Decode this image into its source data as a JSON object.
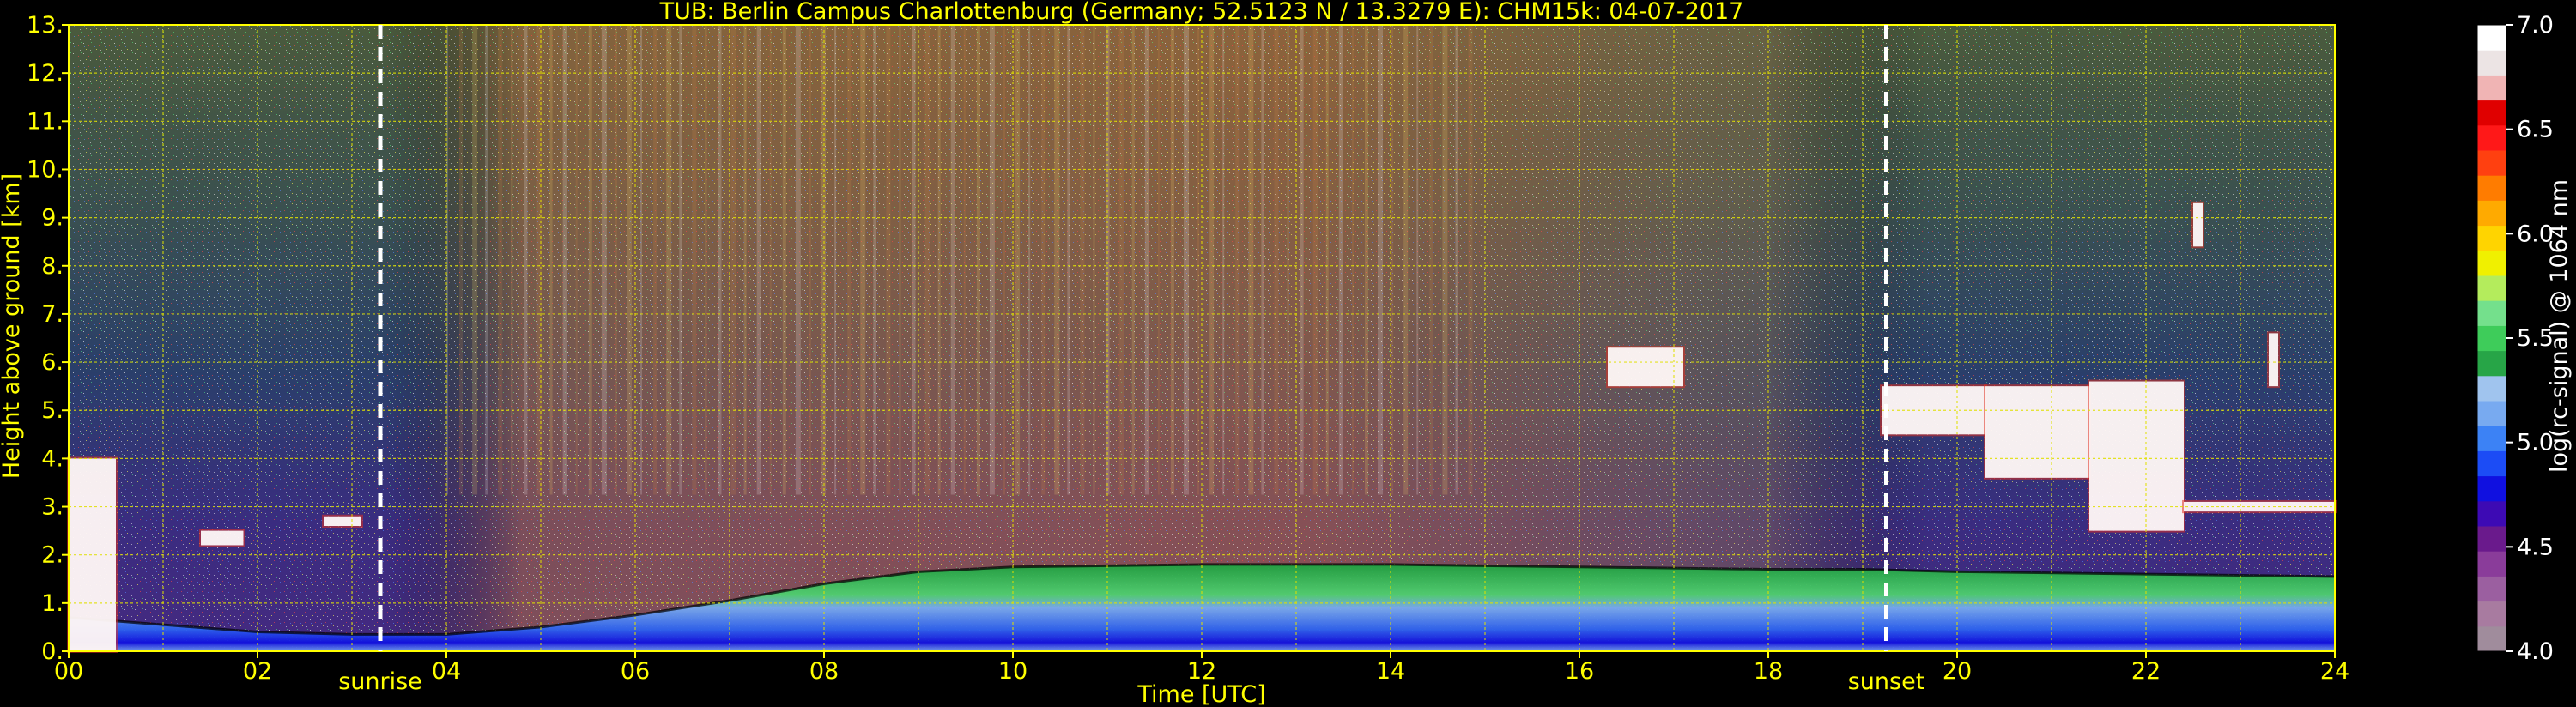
{
  "chart_data": {
    "type": "heatmap",
    "title": "TUB: Berlin Campus Charlottenburg (Germany; 52.5123 N / 13.3279 E):    CHM15k: 04-07-2017",
    "xlabel": "Time [UTC]",
    "ylabel": "Height above ground [km]",
    "xlim": [
      0,
      24
    ],
    "ylim": [
      0,
      13
    ],
    "x_ticks": [
      "00",
      "02",
      "04",
      "06",
      "08",
      "10",
      "12",
      "14",
      "16",
      "18",
      "20",
      "22",
      "24"
    ],
    "y_ticks": [
      "0.",
      "1.",
      "2.",
      "3.",
      "4.",
      "5.",
      "6.",
      "7.",
      "8.",
      "9.",
      "10.",
      "11.",
      "12.",
      "13."
    ],
    "grid": true,
    "annotations": [
      {
        "label": "sunrise",
        "time": 3.3
      },
      {
        "label": "sunset",
        "time": 19.25
      }
    ],
    "colorbar": {
      "label": "log(rc-signal) @ 1064 nm",
      "range": [
        4.0,
        7.0
      ],
      "ticks": [
        "4.0",
        "4.5",
        "5.0",
        "5.5",
        "6.0",
        "6.5",
        "7.0"
      ],
      "colors": [
        "#a08c9c",
        "#a87ba0",
        "#9b5fa0",
        "#8a3c9a",
        "#6a1a8c",
        "#3d0ab4",
        "#1010e0",
        "#1c4cf5",
        "#3c82f5",
        "#78aaf0",
        "#a0c4ee",
        "#27a547",
        "#3ecc5a",
        "#74e08c",
        "#b4ec5c",
        "#f0f000",
        "#ffd400",
        "#ffaa00",
        "#ff7c00",
        "#ff4010",
        "#ff1818",
        "#e00000",
        "#f0b4b4",
        "#ece4e4",
        "#ffffff"
      ]
    },
    "data": {
      "boundary_layer_top_km": [
        {
          "t": 0.0,
          "h": 0.7
        },
        {
          "t": 1.0,
          "h": 0.55
        },
        {
          "t": 2.0,
          "h": 0.4
        },
        {
          "t": 3.0,
          "h": 0.35
        },
        {
          "t": 4.0,
          "h": 0.35
        },
        {
          "t": 5.0,
          "h": 0.5
        },
        {
          "t": 6.0,
          "h": 0.75
        },
        {
          "t": 7.0,
          "h": 1.05
        },
        {
          "t": 8.0,
          "h": 1.4
        },
        {
          "t": 9.0,
          "h": 1.65
        },
        {
          "t": 10.0,
          "h": 1.75
        },
        {
          "t": 12.0,
          "h": 1.8
        },
        {
          "t": 14.0,
          "h": 1.8
        },
        {
          "t": 16.0,
          "h": 1.75
        },
        {
          "t": 18.0,
          "h": 1.7
        },
        {
          "t": 19.0,
          "h": 1.7
        },
        {
          "t": 20.0,
          "h": 1.65
        },
        {
          "t": 22.0,
          "h": 1.6
        },
        {
          "t": 24.0,
          "h": 1.55
        }
      ],
      "cloud_layers": [
        {
          "t_start": 16.3,
          "t_end": 17.1,
          "h_bottom": 5.5,
          "h_top": 6.3
        },
        {
          "t_start": 19.2,
          "t_end": 20.3,
          "h_bottom": 4.5,
          "h_top": 5.5
        },
        {
          "t_start": 20.3,
          "t_end": 21.4,
          "h_bottom": 3.6,
          "h_top": 5.5
        },
        {
          "t_start": 21.4,
          "t_end": 22.4,
          "h_bottom": 2.5,
          "h_top": 5.6
        },
        {
          "t_start": 22.4,
          "t_end": 24.0,
          "h_bottom": 2.9,
          "h_top": 3.1
        },
        {
          "t_start": 22.5,
          "t_end": 22.6,
          "h_bottom": 8.4,
          "h_top": 9.3
        },
        {
          "t_start": 23.3,
          "t_end": 23.4,
          "h_bottom": 5.5,
          "h_top": 6.6
        },
        {
          "t_start": 2.7,
          "t_end": 3.1,
          "h_bottom": 2.6,
          "h_top": 2.8
        },
        {
          "t_start": 1.4,
          "t_end": 1.85,
          "h_bottom": 2.2,
          "h_top": 2.5
        },
        {
          "t_start": 0.0,
          "t_end": 0.5,
          "h_bottom": 0.0,
          "h_top": 4.0
        }
      ]
    }
  }
}
